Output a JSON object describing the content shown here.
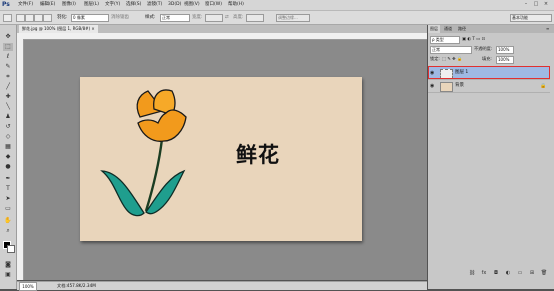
{
  "app": {
    "logo": "Ps"
  },
  "menu": [
    "文件(F)",
    "编辑(E)",
    "图像(I)",
    "图层(L)",
    "文字(Y)",
    "选择(S)",
    "滤镜(T)",
    "3D(D)",
    "视图(V)",
    "窗口(W)",
    "帮助(H)"
  ],
  "window_controls": {
    "minimize": "–",
    "maximize": "□",
    "close": "×"
  },
  "options": {
    "feather_label": "羽化:",
    "feather_value": "0 像素",
    "antialias_label": "消除锯齿",
    "style_label": "样式:",
    "style_value": "正常",
    "width_label": "宽度:",
    "height_label": "高度:",
    "refine_edge": "调整边缘...",
    "workspace": "基本功能"
  },
  "document": {
    "tab_label": "鲜花.jpg @ 100% (图层 1, RGB/8#) ×",
    "canvas_text": "鲜花",
    "zoom": "100%",
    "doc_size": "文档:457.8K/2.34M"
  },
  "colors": {
    "artboard": "#e9d5bb",
    "petal": "#f29a1c",
    "leaf": "#1f9e8e",
    "highlight": "#e03030"
  },
  "layers_panel": {
    "tabs": [
      "图层",
      "通道",
      "路径"
    ],
    "filter_label": "ρ 类型",
    "blend_mode": "正常",
    "opacity_label": "不透明度:",
    "opacity_value": "100%",
    "lock_label": "锁定:",
    "fill_label": "填充:",
    "fill_value": "100%",
    "layers": [
      {
        "name": "图层 1",
        "selected": true
      },
      {
        "name": "背景",
        "selected": false
      }
    ]
  },
  "icons": {
    "tools": [
      "move-tool-icon",
      "marquee-tool-icon",
      "lasso-tool-icon",
      "quick-select-icon",
      "crop-tool-icon",
      "eyedropper-icon",
      "healing-brush-icon",
      "brush-tool-icon",
      "clone-stamp-icon",
      "history-brush-icon",
      "eraser-icon",
      "gradient-tool-icon",
      "blur-tool-icon",
      "dodge-tool-icon",
      "pen-tool-icon",
      "type-tool-icon",
      "path-select-icon",
      "shape-tool-icon",
      "hand-tool-icon",
      "zoom-tool-icon"
    ]
  }
}
